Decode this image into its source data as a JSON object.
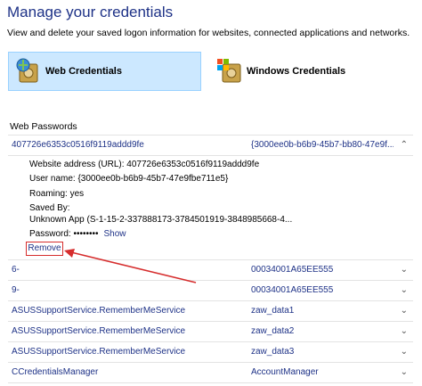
{
  "header": {
    "title": "Manage your credentials",
    "subtitle": "View and delete your saved logon information for websites, connected applications and networks."
  },
  "tabs": [
    {
      "label": "Web Credentials",
      "icon": "web-credentials-vault-icon",
      "selected": true
    },
    {
      "label": "Windows Credentials",
      "icon": "windows-credentials-vault-icon",
      "selected": false
    }
  ],
  "section_title": "Web Passwords",
  "expanded_item": {
    "name": "407726e6353c0516f9119addd9fe",
    "user": "{3000ee0b-b6b9-45b7-bb80-47e9f...",
    "website": "Website address (URL):  407726e6353c0516f9119addd9fe",
    "username": "User name:  {3000ee0b-b6b9-45b7-47e9fbe711e5}",
    "roaming": "Roaming:  yes",
    "saved_by_label": "Saved By:",
    "saved_by_value": "Unknown App (S-1-15-2-337888173-3784501919-3848985668-4...",
    "password_label": "Password:  ••••••••",
    "show_label": "Show",
    "remove_label": "Remove"
  },
  "items": [
    {
      "name": "6-",
      "user": "00034001A65EE555"
    },
    {
      "name": "9-",
      "user": "00034001A65EE555"
    },
    {
      "name": "ASUSSupportService.RememberMeService",
      "user": "zaw_data1"
    },
    {
      "name": "ASUSSupportService.RememberMeService",
      "user": "zaw_data2"
    },
    {
      "name": "ASUSSupportService.RememberMeService",
      "user": "zaw_data3"
    },
    {
      "name": "CCredentialsManager",
      "user": "AccountManager"
    }
  ],
  "colors": {
    "accent": "#1e3287",
    "selected_tab": "#cce8ff",
    "annotation": "#d62d2d"
  }
}
